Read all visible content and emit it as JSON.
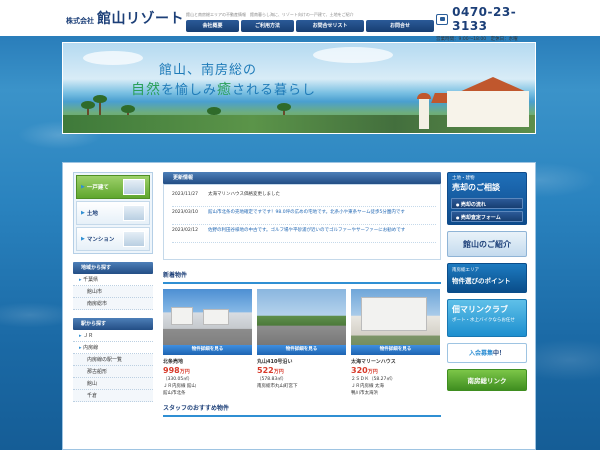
{
  "header": {
    "logo_prefix": "株式会社",
    "logo_name": "館山リゾート",
    "tagline": "館山と南房総エリアの不動産情報　館南暮らし海に、リゾート向けの一戸建て、土地をご紹介",
    "phone": "0470-23-3133",
    "hours": "営業時間：9:00～18:00　定休日：水曜"
  },
  "nav": [
    {
      "label": "会社概要"
    },
    {
      "label": "ご利用方法"
    },
    {
      "label": "お問合せリスト"
    },
    {
      "label": "お問合せ"
    }
  ],
  "hero": {
    "title_line1": "館山、南房総の",
    "title_line2_a": "自",
    "title_line2_b": "然",
    "title_line2_c": "を愉しみ",
    "title_line2_d": "癒",
    "title_line2_e": "される暮らし"
  },
  "sidebar_left": {
    "categories": [
      {
        "label": "一戸建て",
        "active": true
      },
      {
        "label": "土地",
        "active": false
      },
      {
        "label": "マンション",
        "active": false
      }
    ],
    "area_head": "地域から探す",
    "areas": [
      {
        "label": "千葉県",
        "sub": false
      },
      {
        "label": "館山市",
        "sub": true
      },
      {
        "label": "南房総市",
        "sub": true
      }
    ],
    "station_head": "駅から探す",
    "stations": [
      {
        "label": "ＪＲ",
        "sub": false
      },
      {
        "label": "内房線",
        "sub": false
      },
      {
        "label": "内房線の駅一覧",
        "sub": true
      },
      {
        "label": "那古船形",
        "sub": true
      },
      {
        "label": "館山",
        "sub": true
      },
      {
        "label": "千倉",
        "sub": true
      }
    ]
  },
  "news": {
    "head": "更新情報",
    "items": [
      {
        "date": "2023/11/27",
        "text": "太海マリンハウス価格変更しました",
        "link": false
      },
      {
        "date": "2023/03/10",
        "text": "館山市北条の売地確定ですです！98.0坪の広めの宅地です。北条小や東条ヤーム徒歩5分圏内です",
        "link": true
      },
      {
        "date": "2023/02/12",
        "text": "佐野の利田谷様地の中古です。ゴルフ場や平砂浦が近いのでゴルファーやサーファーにお勧めです",
        "link": true
      }
    ]
  },
  "new_props": {
    "head": "新着物件",
    "detail_label": "物件詳細を見る",
    "items": [
      {
        "name": "北条売地",
        "price": "998",
        "unit": "万円",
        "area": "（330.05㎡）",
        "line": "ＪＲ内房線 館山",
        "addr": "館山市北条"
      },
      {
        "name": "丸山410号沿い",
        "price": "522",
        "unit": "万円",
        "area": "（578.83㎡）",
        "line": "",
        "addr": "南房総市丸山町宮下"
      },
      {
        "name": "太海マリーンハウス",
        "price": "320",
        "unit": "万円",
        "area": "２ＳＤＫ（58.27㎡）",
        "line": "ＪＲ内房線 太海",
        "addr": "鴨川市太海浜"
      }
    ]
  },
  "staff_head": "スタッフのおすすめ物件",
  "sidebar_right": {
    "sell_tag": "土地・建物",
    "sell_title": "売却のご相談",
    "sell_btn1": "売却の流れ",
    "sell_btn2": "売却査定フォーム",
    "intro": "館山のご紹介",
    "point_small": "南房総エリア",
    "point_big": "物件選びのポイント",
    "marina_big": "佃マリンクラブ",
    "marina_small": "ボート・水上バイクならお任せ",
    "entry_a": "入会募集",
    "entry_b": "中！",
    "link_btn": "南房総リンク"
  },
  "colors": {
    "accent": "#1c3f78",
    "price": "#d83a2a",
    "green": "#5fa62e"
  }
}
